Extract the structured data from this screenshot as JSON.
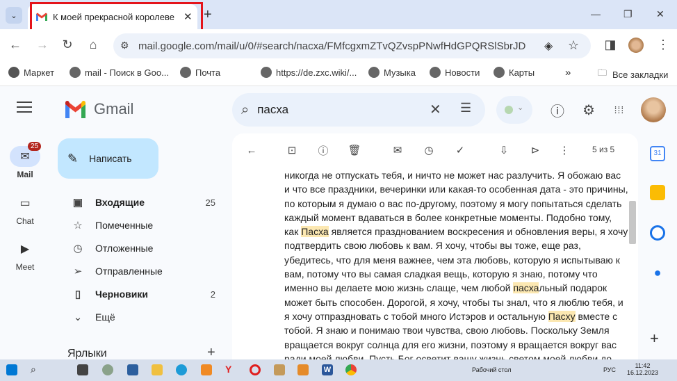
{
  "browser": {
    "tab": {
      "title": "К моей прекрасной королеве",
      "close": "✕"
    },
    "new_tab": "+",
    "url": "mail.google.com/mail/u/0/#search/пасха/FMfcgxmZTvQZvspPNwfHdGPQRSlSbrJD",
    "bookmarks": [
      "Маркет",
      "mail - Поиск в Goo...",
      "Почта",
      "https://de.zxc.wiki/...",
      "Музыка",
      "Новости",
      "Карты",
      "Все закладки"
    ],
    "more_bookmarks": "»"
  },
  "gmail": {
    "logo": "Gmail",
    "search": {
      "value": "пасха"
    },
    "rail": [
      {
        "label": "Mail",
        "badge": "25"
      },
      {
        "label": "Chat"
      },
      {
        "label": "Meet"
      }
    ],
    "compose": "Написать",
    "folders": [
      {
        "label": "Входящие",
        "count": "25"
      },
      {
        "label": "Помеченные",
        "count": ""
      },
      {
        "label": "Отложенные",
        "count": ""
      },
      {
        "label": "Отправленные",
        "count": ""
      },
      {
        "label": "Черновики",
        "count": "2"
      },
      {
        "label": "Ещё",
        "count": ""
      }
    ],
    "labels_heading": "Ярлыки",
    "labels_add": "+",
    "pager": "5 из 5",
    "body_lines": [
      [
        "никогда не отпускать тебя, и ничто не может нас разлучить. Я обожаю вас"
      ],
      [
        "и что все праздники, вечеринки или какая-то особенная дата - это причины,"
      ],
      [
        "по которым я думаю о вас по-другому, поэтому я могу попытаться сделать"
      ],
      [
        "каждый момент вдаваться в более конкретные моменты. Подобно тому,"
      ],
      [
        "как ",
        "Пасха",
        " является празднованием воскресения и обновления веры, я хочу"
      ],
      [
        "подтвердить свою любовь к вам. Я хочу, чтобы вы тоже, еще раз,"
      ],
      [
        "убедитесь, что для меня важнее, чем эта любовь, которую я испытываю к"
      ],
      [
        "вам, потому что вы самая сладкая вещь, которую я знаю, потому что"
      ],
      [
        "именно вы делаете мою жизнь слаще, чем любой ",
        "пасха",
        "льный подарок"
      ],
      [
        "может быть способен. Дорогой, я хочу, чтобы ты знал, что я люблю тебя, и"
      ],
      [
        "я хочу отпраздновать с тобой много Истэров и остальную ",
        "Пасху",
        " вместе с"
      ],
      [
        "тобой. Я знаю и понимаю твои чувства, свою любовь. Поскольку Земля"
      ],
      [
        "вращается вокруг солнца для его жизни, поэтому я вращается вокруг вас"
      ],
      [
        "ради моей любви. Пусть Бог осветит вашу жизнь светом моей любви до"
      ]
    ]
  },
  "taskbar": {
    "desktop_label": "Рабочий стол",
    "lang": "РУС",
    "time": "11:42",
    "date": "16.12.2023"
  },
  "colors": {
    "accent": "#0b57d0",
    "highlight": "#fce8b2",
    "compose_bg": "#c2e7ff",
    "badge": "#b3261e"
  }
}
